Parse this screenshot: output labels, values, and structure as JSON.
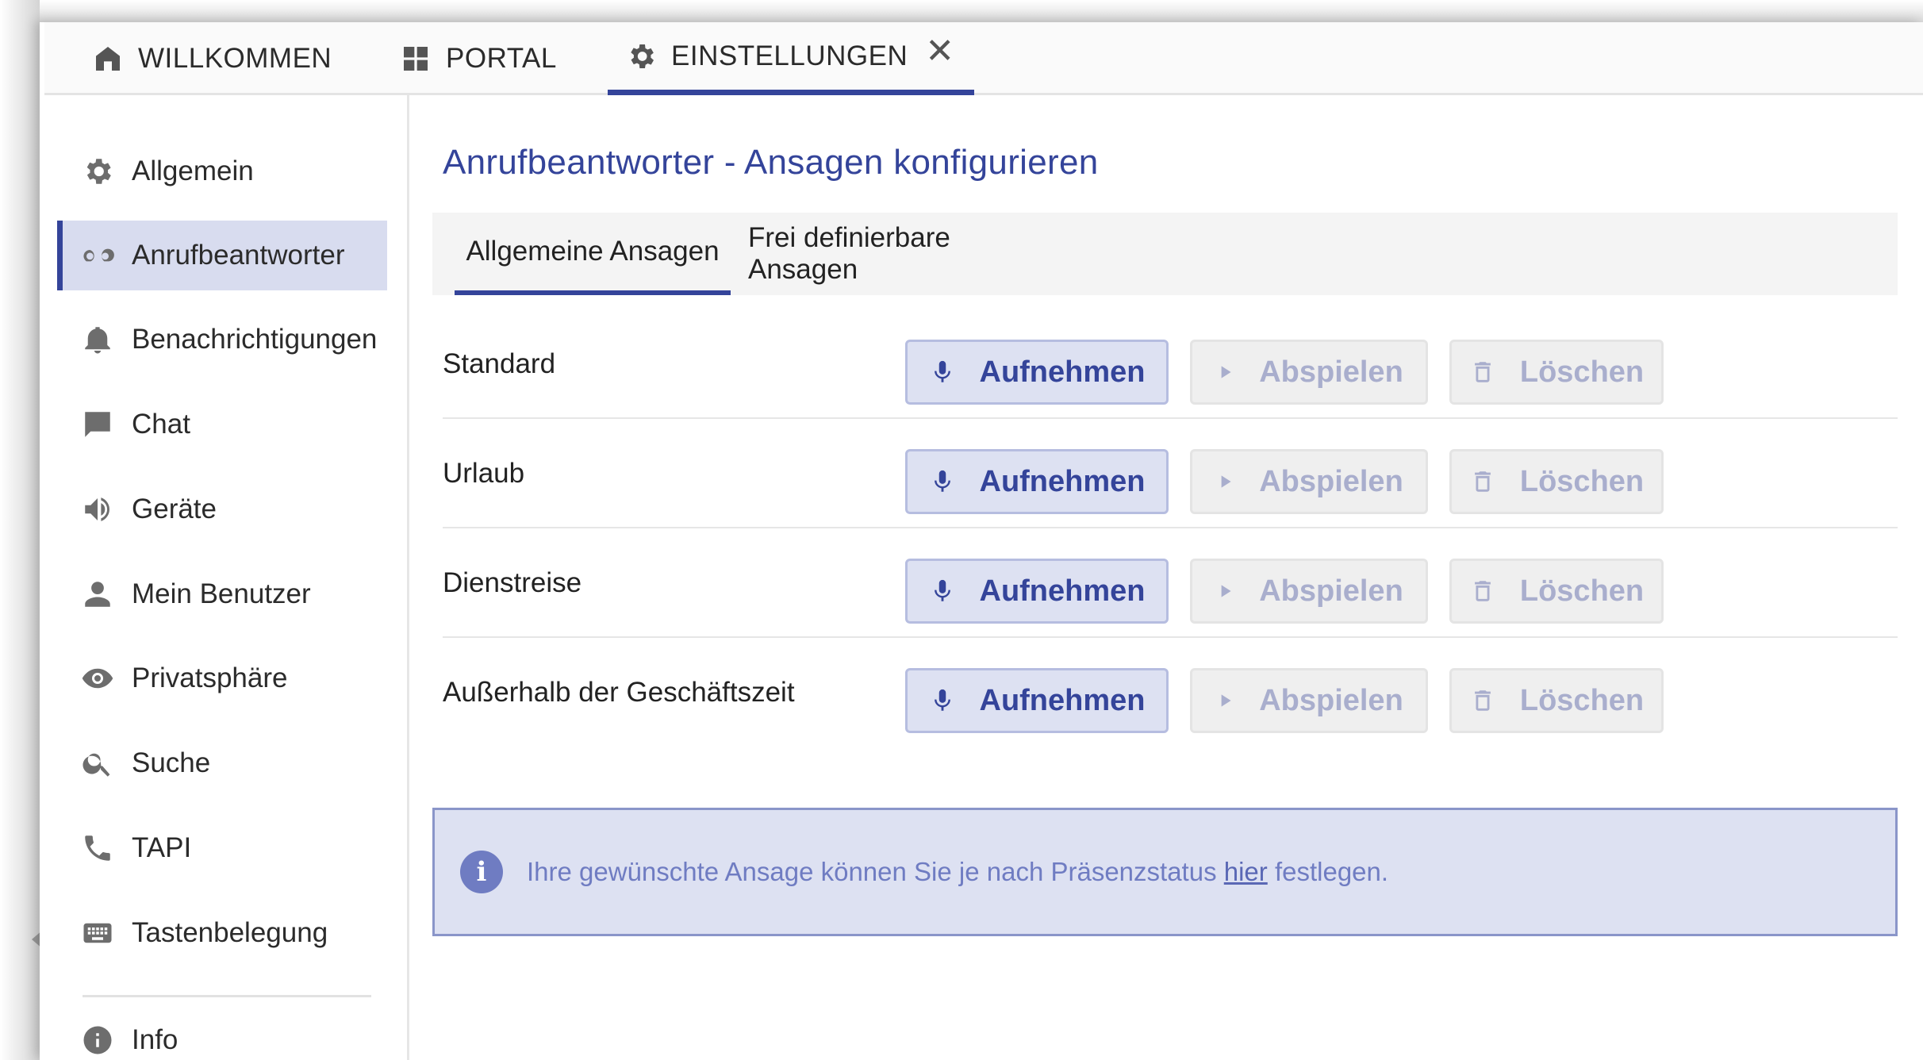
{
  "top_tabs": [
    {
      "label": "WILLKOMMEN",
      "icon": "home-icon"
    },
    {
      "label": "PORTAL",
      "icon": "grid-icon"
    },
    {
      "label": "EINSTELLUNGEN",
      "icon": "gear-icon",
      "active": true,
      "close": "✕"
    }
  ],
  "sidebar": {
    "items": [
      {
        "label": "Allgemein",
        "icon": "gear-icon"
      },
      {
        "label": "Anrufbeantworter",
        "icon": "voicemail-icon",
        "active": true
      },
      {
        "label": "Benachrichtigungen",
        "icon": "bell-icon"
      },
      {
        "label": "Chat",
        "icon": "chat-icon"
      },
      {
        "label": "Geräte",
        "icon": "speaker-icon"
      },
      {
        "label": "Mein Benutzer",
        "icon": "user-icon"
      },
      {
        "label": "Privatsphäre",
        "icon": "eye-icon"
      },
      {
        "label": "Suche",
        "icon": "search-icon"
      },
      {
        "label": "TAPI",
        "icon": "phone-icon"
      },
      {
        "label": "Tastenbelegung",
        "icon": "keyboard-icon"
      },
      {
        "label": "Info",
        "icon": "info-icon"
      }
    ]
  },
  "main": {
    "title": "Anrufbeantworter - Ansagen konfigurieren",
    "subtabs": [
      {
        "label": "Allgemeine Ansagen",
        "active": true
      },
      {
        "label": "Frei definierbare Ansagen"
      }
    ],
    "buttons": {
      "record": "Aufnehmen",
      "play": "Abspielen",
      "delete": "Löschen"
    },
    "rows": [
      {
        "label": "Standard"
      },
      {
        "label": "Urlaub"
      },
      {
        "label": "Dienstreise"
      },
      {
        "label": "Außerhalb der Geschäftszeit"
      }
    ],
    "info": {
      "before": "Ihre gewünschte Ansage können Sie je nach Präsenzstatus ",
      "link": "hier",
      "after": " festlegen."
    }
  },
  "colors": {
    "accent": "#34449a",
    "active_bg": "#d8dcef",
    "info_text": "#6f7cc2",
    "disabled_text": "#a9aecd"
  }
}
